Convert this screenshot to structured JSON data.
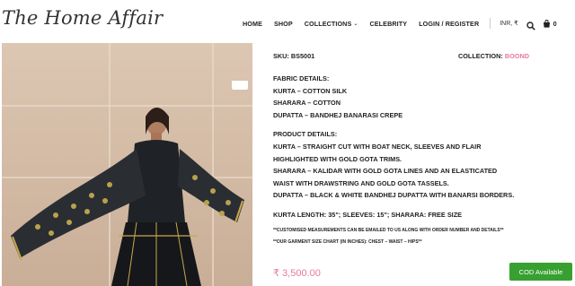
{
  "header": {
    "logo": "The Home Affair",
    "nav": {
      "home": "HOME",
      "shop": "SHOP",
      "collections": "COLLECTIONS",
      "celebrity": "CELEBRITY",
      "login": "LOGIN / REGISTER"
    },
    "currency": "INR, ₹",
    "cart_count": "0"
  },
  "product": {
    "sku_label": "SKU: BS5001",
    "collection_label": "COLLECTION:",
    "collection_value": "BOOND",
    "fabric": {
      "heading": "FABRIC DETAILS:",
      "kurta": "KURTA – COTTON SILK",
      "sharara": "SHARARA – COTTON",
      "dupatta": "DUPATTA – BANDHEJ BANARASI CREPE"
    },
    "details": {
      "heading": "PRODUCT DETAILS:",
      "line1": "KURTA – STRAIGHT CUT WITH BOAT NECK, SLEEVES AND FLAIR",
      "line2": "HIGHLIGHTED WITH GOLD GOTA TRIMS.",
      "line3": "SHARARA – KALIDAR WITH GOLD GOTA LINES AND AN ELASTICATED",
      "line4": "WAIST WITH DRAWSTRING AND GOLD GOTA TASSELS.",
      "line5": "DUPATTA – BLACK & WHITE BANDHEJ DUPATTA WITH BANARSI BORDERS."
    },
    "lengths": "KURTA LENGTH: 35\"; SLEEVES: 15\"; SHARARA: FREE SIZE",
    "note1": "**CUSTOMISED MEASUREMENTS CAN BE EMAILED TO US ALONG WITH ORDER NUMBER AND DETAILS**",
    "note2": "**OUR GARMENT SIZE CHART (IN INCHES): CHEST – WAIST – HIPS**",
    "price": "₹ 3,500.00",
    "cod": "COD Available"
  },
  "colors": {
    "accent_pink": "#e87a9a",
    "cod_green": "#37a030"
  }
}
